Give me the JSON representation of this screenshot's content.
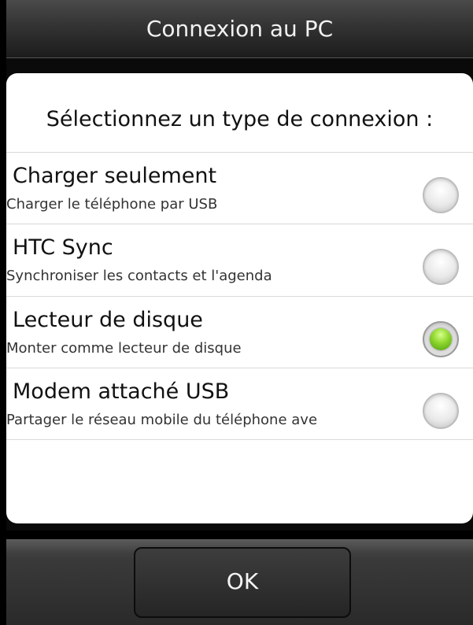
{
  "window": {
    "title": "Connexion au PC"
  },
  "dialog": {
    "prompt": "Sélectionnez un type de connexion :",
    "options": [
      {
        "title": "Charger seulement",
        "subtitle": "Charger le téléphone par USB",
        "selected": false
      },
      {
        "title": "HTC Sync",
        "subtitle": "Synchroniser les contacts et l'agenda",
        "selected": false
      },
      {
        "title": "Lecteur de disque",
        "subtitle": "Monter comme lecteur de disque",
        "selected": true
      },
      {
        "title": "Modem attaché USB",
        "subtitle": "Partager le réseau mobile du téléphone ave",
        "selected": false
      }
    ]
  },
  "footer": {
    "ok_label": "OK"
  },
  "colors": {
    "selected_radio": "#8ed62c",
    "dialog_background": "#ffffff",
    "screen_background": "#000000"
  }
}
